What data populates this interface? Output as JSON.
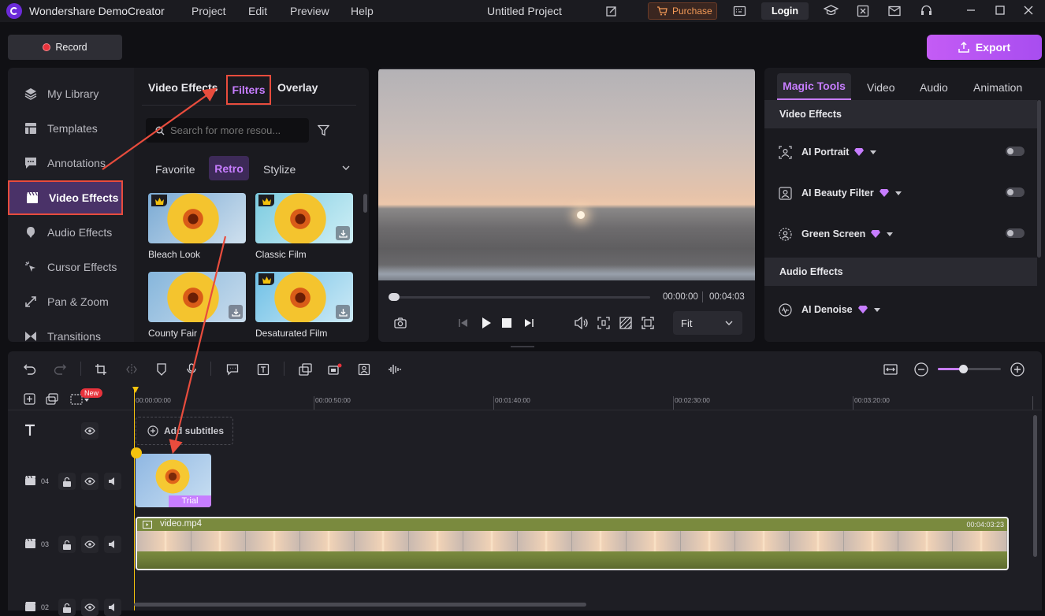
{
  "app": {
    "title": "Wondershare DemoCreator",
    "project_name": "Untitled Project"
  },
  "menu": [
    "Project",
    "Edit",
    "Preview",
    "Help"
  ],
  "titlebar": {
    "purchase_label": "Purchase",
    "login_label": "Login"
  },
  "record": {
    "label": "Record"
  },
  "export": {
    "label": "Export"
  },
  "sidebar": {
    "items": [
      {
        "label": "My Library",
        "icon": "layers-icon"
      },
      {
        "label": "Templates",
        "icon": "templates-icon"
      },
      {
        "label": "Annotations",
        "icon": "annotation-icon"
      },
      {
        "label": "Video Effects",
        "icon": "clapper-icon",
        "active": true
      },
      {
        "label": "Audio Effects",
        "icon": "audio-effects-icon"
      },
      {
        "label": "Cursor Effects",
        "icon": "cursor-icon"
      },
      {
        "label": "Pan & Zoom",
        "icon": "pan-zoom-icon"
      },
      {
        "label": "Transitions",
        "icon": "transition-icon"
      }
    ]
  },
  "effects_panel": {
    "tabs": [
      "Video Effects",
      "Filters",
      "Overlay"
    ],
    "active_tab": "Filters",
    "search_placeholder": "Search for more resou...",
    "categories": [
      "Favorite",
      "Retro",
      "Stylize"
    ],
    "active_category": "Retro",
    "filters": [
      {
        "label": "Bleach Look",
        "premium": true,
        "download": false
      },
      {
        "label": "Classic Film",
        "premium": true,
        "download": true
      },
      {
        "label": "County Fair",
        "premium": false,
        "download": true
      },
      {
        "label": "Desaturated Film",
        "premium": true,
        "download": true
      }
    ]
  },
  "preview": {
    "current_time": "00:00:00",
    "total_time": "00:04:03",
    "progress": 0.0,
    "zoom_label": "Fit"
  },
  "right_panel": {
    "tabs": [
      "Magic Tools",
      "Video",
      "Audio",
      "Animation"
    ],
    "active_tab": "Magic Tools",
    "video_effects_heading": "Video Effects",
    "video_tools": [
      {
        "label": "AI Portrait",
        "on": false
      },
      {
        "label": "AI Beauty Filter",
        "on": false
      },
      {
        "label": "Green Screen",
        "on": false
      }
    ],
    "audio_effects_heading": "Audio Effects",
    "audio_tools": [
      {
        "label": "AI Denoise"
      }
    ]
  },
  "timeline": {
    "ruler": [
      "00:00:00:00",
      "00:00:50:00",
      "00:01:40:00",
      "00:02:30:00",
      "00:03:20:00"
    ],
    "new_badge": "New",
    "add_subtitles": "Add subtitles",
    "tracks": [
      {
        "num": "04",
        "clip_badge": "Trial"
      },
      {
        "num": "03",
        "clip_name": "video.mp4",
        "clip_duration": "00:04:03:23"
      },
      {
        "num": "02"
      }
    ],
    "zoom_level": 0.4
  },
  "colors": {
    "accent": "#a259ff",
    "highlight_red": "#e84c3d",
    "purchase": "#f39a57",
    "video_track": "#7a8a3e"
  }
}
